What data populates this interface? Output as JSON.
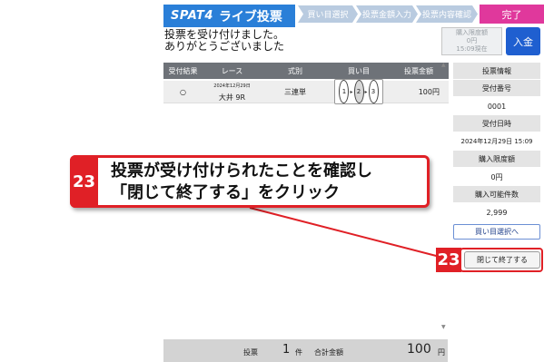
{
  "header": {
    "brand": "SPAT4",
    "title": "ライブ投票",
    "steps": [
      "買い目選択",
      "投票金額入力",
      "投票内容確認",
      "完了"
    ]
  },
  "message": {
    "line1": "投票を受け付けました。",
    "line2": "ありがとうございました"
  },
  "limit_box": {
    "label": "購入限度額",
    "amount": "0円",
    "time": "15:09現在"
  },
  "deposit_label": "入金",
  "table": {
    "headers": [
      "受付結果",
      "レース",
      "式別",
      "買い目",
      "投票金額"
    ],
    "row": {
      "result": "○",
      "date": "2024年12月29日",
      "race": "大井 9R",
      "bet_type": "三連単",
      "combo": [
        "1",
        "2",
        "3"
      ],
      "amount": "100円"
    }
  },
  "panel": {
    "title": "投票情報",
    "receipt_label": "受付番号",
    "receipt_value": "0001",
    "datetime_label": "受付日時",
    "datetime_value": "2024年12月29日 15:09",
    "limit_label": "購入限度額",
    "limit_value": "0円",
    "count_label": "購入可能件数",
    "count_value": "2,999"
  },
  "buttons": {
    "back": "買い目選択へ",
    "close": "閉じて終了する"
  },
  "annotation": {
    "step_number": "23",
    "line1": "投票が受け付けられたことを確認し",
    "line2": "「閉じて終了する」をクリック"
  },
  "footer": {
    "vote_label": "投票",
    "count": "1",
    "count_unit": "件",
    "total_label": "合計金額",
    "total": "100",
    "total_unit": "円"
  },
  "colors": {
    "accent_blue": "#2a7fd8",
    "complete_pink": "#e0389c",
    "annotation_red": "#e02026"
  }
}
